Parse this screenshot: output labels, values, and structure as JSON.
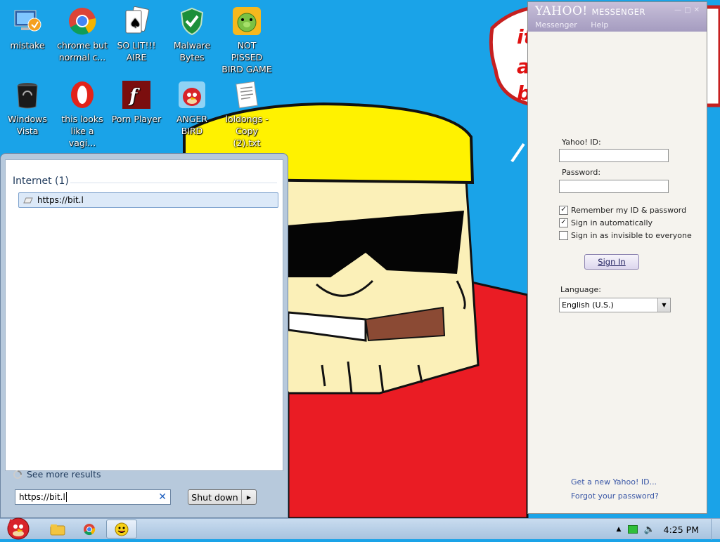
{
  "desktop": {
    "icons": [
      {
        "label": "mistake",
        "icon": "computer-icon"
      },
      {
        "label": "chrome but normal c...",
        "icon": "chrome-icon"
      },
      {
        "label": "SO LIT!!! AIRE",
        "icon": "cards-icon"
      },
      {
        "label": "Malware Bytes",
        "icon": "shield-icon"
      },
      {
        "label": "NOT PISSED BIRD GAME",
        "icon": "pig-icon"
      },
      {
        "label": "Windows Vista",
        "icon": "trash-icon"
      },
      {
        "label": "this looks like a vagi...",
        "icon": "opera-icon"
      },
      {
        "label": "Porn Player",
        "icon": "flash-icon"
      },
      {
        "label": "ANGER BIRD",
        "icon": "angry-bird-icon"
      },
      {
        "label": "loldongs - Copy (2).txt",
        "icon": "text-file-icon"
      }
    ]
  },
  "start_menu": {
    "section_header": "Internet (1)",
    "result": "https://bit.l",
    "see_more": "See more results",
    "search_value": "https://bit.l",
    "shutdown_label": "Shut down"
  },
  "yahoo": {
    "title_brand": "YAHOO!",
    "title_product": "MESSENGER",
    "menu": [
      "Messenger",
      "Help"
    ],
    "yahoo_id_label": "Yahoo! ID:",
    "yahoo_id_value": "",
    "password_label": "Password:",
    "password_value": "",
    "remember_label": "Remember my ID & password",
    "remember_checked": true,
    "auto_label": "Sign in automatically",
    "auto_checked": true,
    "invisible_label": "Sign in as invisible to everyone",
    "invisible_checked": false,
    "sign_in": "Sign In",
    "language_label": "Language:",
    "language_value": "English (U.S.)",
    "new_id_link": "Get a new Yahoo! ID...",
    "forgot_link": "Forgot your password?"
  },
  "taskbar": {
    "clock": "4:25 PM"
  }
}
